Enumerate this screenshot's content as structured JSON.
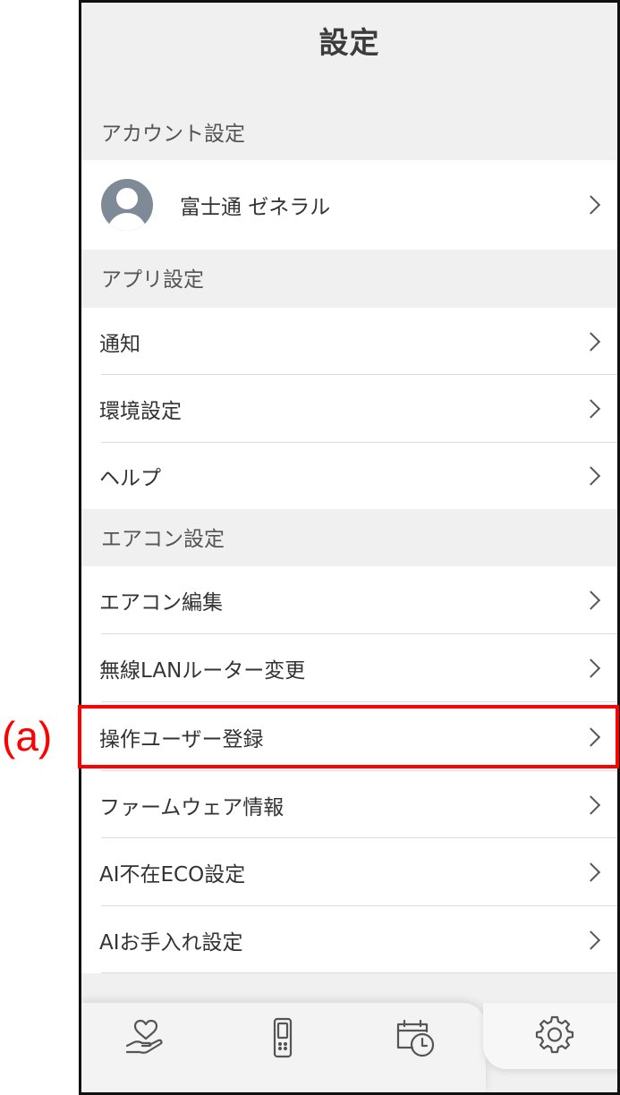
{
  "header": {
    "title": "設定"
  },
  "sections": {
    "account": {
      "header": "アカウント設定",
      "user_name": "富士通 ゼネラル"
    },
    "app": {
      "header": "アプリ設定",
      "items": [
        "通知",
        "環境設定",
        "ヘルプ"
      ]
    },
    "aircon": {
      "header": "エアコン設定",
      "items": [
        "エアコン編集",
        "無線LANルーター変更",
        "操作ユーザー登録",
        "ファームウェア情報",
        "AI不在ECO設定",
        "AIお手入れ設定"
      ]
    }
  },
  "bottom_nav": {
    "items": [
      {
        "icon": "heart-hand-icon"
      },
      {
        "icon": "remote-control-icon"
      },
      {
        "icon": "calendar-clock-icon"
      },
      {
        "icon": "gear-icon",
        "active": true
      }
    ]
  },
  "annotation": {
    "label": "(a)",
    "color": "#ff0000"
  }
}
